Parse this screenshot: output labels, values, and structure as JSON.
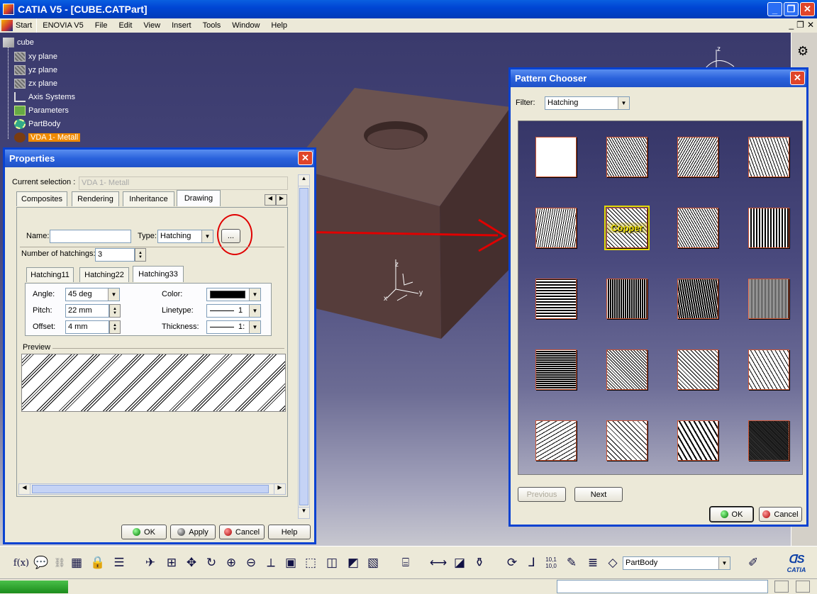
{
  "window": {
    "title": "CATIA V5 - [CUBE.CATPart]",
    "min": "_",
    "max": "❐",
    "close": "✕"
  },
  "menu": {
    "items": [
      "Start",
      "ENOVIA V5",
      "File",
      "Edit",
      "View",
      "Insert",
      "Tools",
      "Window",
      "Help"
    ],
    "mdi": [
      "_",
      "❐",
      "✕"
    ]
  },
  "tree": {
    "root": "cube",
    "items": [
      "xy plane",
      "yz plane",
      "zx plane",
      "Axis Systems",
      "Parameters",
      "PartBody",
      "VDA 1- Metall"
    ]
  },
  "compass": {
    "z": "z"
  },
  "axes": {
    "x": "x",
    "y": "y",
    "z": "z"
  },
  "properties": {
    "title": "Properties",
    "current_selection_label": "Current selection :",
    "current_selection_value": "VDA 1- Metall",
    "tabs": [
      "Composites",
      "Rendering",
      "Inheritance",
      "Drawing"
    ],
    "name_label": "Name:",
    "name_value": "",
    "type_label": "Type:",
    "type_value": "Hatching",
    "browse_label": "...",
    "num_hatchings_label": "Number of hatchings:",
    "num_hatchings_value": "3",
    "hatch_tabs": [
      "Hatching11",
      "Hatching22",
      "Hatching33"
    ],
    "angle_label": "Angle:",
    "angle_value": "45 deg",
    "pitch_label": "Pitch:",
    "pitch_value": "22 mm",
    "offset_label": "Offset:",
    "offset_value": "4 mm",
    "color_label": "Color:",
    "color_value": "#000000",
    "linetype_label": "Linetype:",
    "linetype_value": "1",
    "thickness_label": "Thickness:",
    "thickness_value": "1:",
    "preview_label": "Preview",
    "ok": "OK",
    "apply": "Apply",
    "cancel": "Cancel",
    "help": "Help"
  },
  "pattern_chooser": {
    "title": "Pattern Chooser",
    "filter_label": "Filter:",
    "filter_value": "Hatching",
    "selected_label": "Copper",
    "previous": "Previous",
    "next": "Next",
    "ok": "OK",
    "cancel": "Cancel"
  },
  "toolbar": {
    "formula": "f(x)",
    "scale_label": "10,1\n10,0",
    "body_combo": "PartBody",
    "catia_logo": "CATIA"
  },
  "colors": {
    "highlight_red": "#e00000",
    "selection_orange": "#f08a00",
    "cube_brown": "#5e4542"
  }
}
